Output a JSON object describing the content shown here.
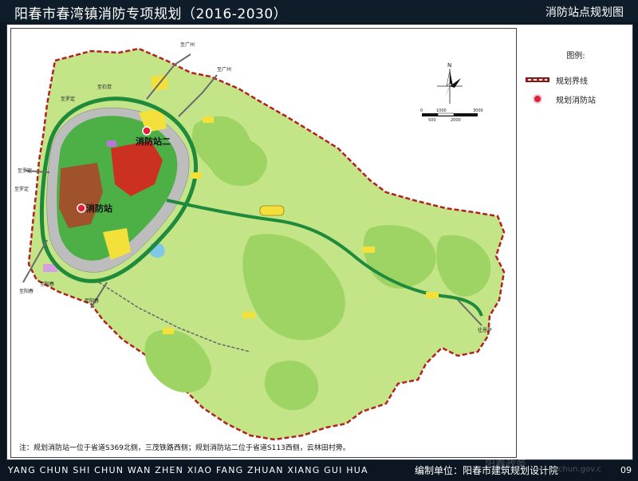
{
  "header": {
    "title": "阳春市春湾镇消防专项规划（2016-2030）",
    "subtitle": "消防站点规划图"
  },
  "map": {
    "directions": [
      {
        "id": "guangzhou_n",
        "text": "至广州"
      },
      {
        "id": "guangzhou_e",
        "text": "至广州"
      },
      {
        "id": "shijue",
        "text": "至石觉"
      },
      {
        "id": "luoding_1",
        "text": "至罗定"
      },
      {
        "id": "luoding_2",
        "text": "至罗定"
      },
      {
        "id": "luoding_3",
        "text": "至罗定"
      },
      {
        "id": "yangchun_1",
        "text": "至阳春"
      },
      {
        "id": "yangchun_2",
        "text": "至阳春"
      },
      {
        "id": "yangchun_3",
        "text": "至阳春"
      },
      {
        "id": "xinxing",
        "text": "往恩平"
      }
    ],
    "stations": [
      {
        "id": "station_1",
        "label": "消防站"
      },
      {
        "id": "station_2",
        "label": "消防站二"
      }
    ],
    "compass": {
      "north": "N"
    },
    "scale_bar": {
      "top_labels": [
        "0",
        "1000",
        "3000"
      ],
      "bottom_labels": [
        "500",
        "2000"
      ]
    },
    "note": "注：规划消防站一位于省道S369北侧，三茂铁路西侧；规划消防站二位于省道S113西侧，云林田村旁。"
  },
  "legend": {
    "title": "图例:",
    "items": [
      {
        "label": "规划界线"
      },
      {
        "label": "规划消防站"
      }
    ]
  },
  "footer": {
    "pinyin": "YANG CHUN SHI CHUN WAN ZHEN XIAO FANG ZHUAN XIANG GUI HUA",
    "unit": "编制单位：阳春市建筑规划设计院",
    "page": "09",
    "watermark": "阳春政务",
    "watermark2": "chun.gov.c"
  },
  "colors": {
    "boundary": "#b32020",
    "light_green": "#b9e07a",
    "mid_green": "#8fcf57",
    "dark_green": "#3fae3a",
    "built_red": "#cc3020",
    "built_brown": "#a0522d",
    "gray": "#bdbdbd",
    "station": "#e0203a"
  }
}
